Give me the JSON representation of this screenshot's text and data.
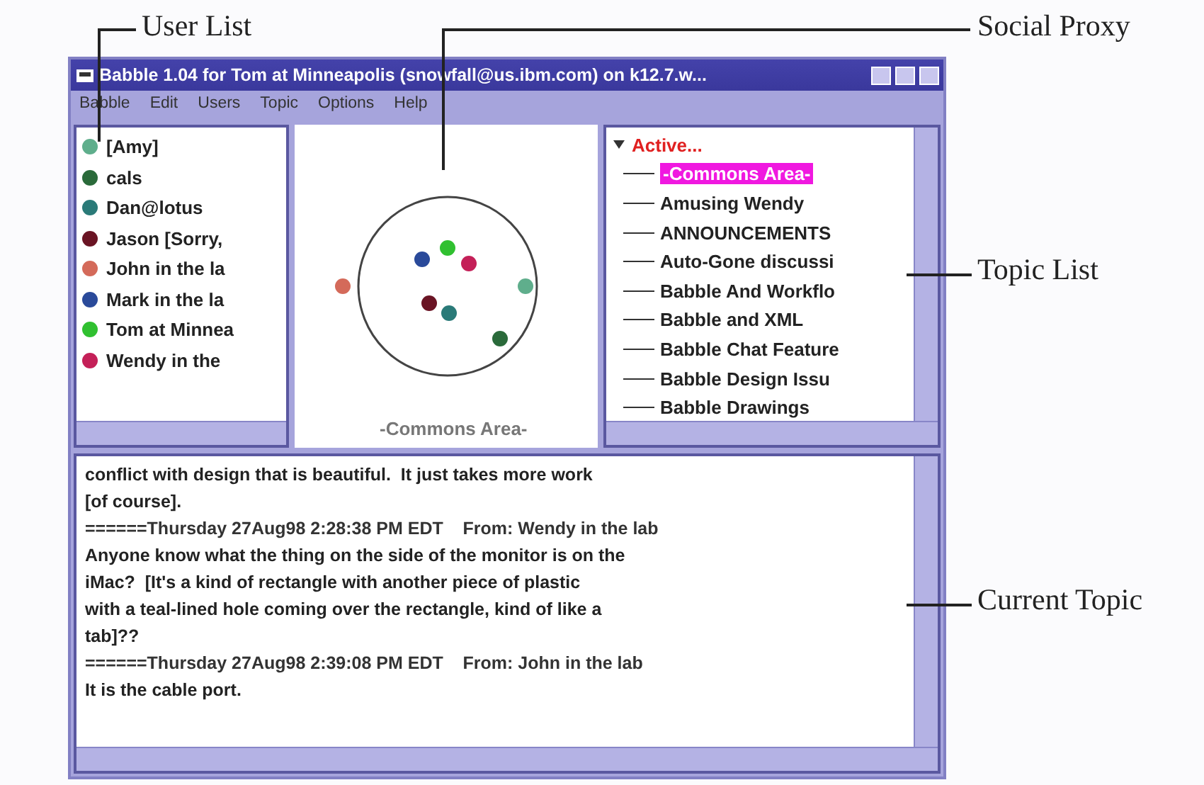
{
  "callouts": [
    {
      "label": "User List"
    },
    {
      "label": "Social Proxy"
    },
    {
      "label": "Topic List"
    },
    {
      "label": "Current Topic"
    }
  ],
  "window": {
    "title": "Babble 1.04 for Tom at Minneapolis (snowfall@us.ibm.com) on k12.7.w..."
  },
  "menu": [
    "Babble",
    "Edit",
    "Users",
    "Topic",
    "Options",
    "Help"
  ],
  "users": [
    {
      "name": "[Amy]",
      "color": "#5fae8c"
    },
    {
      "name": "cals",
      "color": "#2a6a3a"
    },
    {
      "name": "Dan@lotus",
      "color": "#2a7a78"
    },
    {
      "name": "Jason [Sorry, ",
      "color": "#6a1424"
    },
    {
      "name": "John in the la",
      "color": "#d46a5a"
    },
    {
      "name": "Mark in the la",
      "color": "#2a4a9a"
    },
    {
      "name": "Tom at Minnea",
      "color": "#30c030"
    },
    {
      "name": "Wendy in the",
      "color": "#c42058"
    }
  ],
  "proxy": {
    "place": "-Commons Area-"
  },
  "topics": [
    {
      "label": "Active...",
      "expanded": true,
      "children": [
        {
          "label": "-Commons Area-",
          "selected": true
        },
        {
          "label": "Amusing Wendy",
          "selected": false
        },
        {
          "label": "ANNOUNCEMENTS",
          "selected": false
        },
        {
          "label": "Auto-Gone discussi",
          "selected": false
        },
        {
          "label": "Babble And Workflo",
          "selected": false
        },
        {
          "label": "Babble and XML",
          "selected": false
        },
        {
          "label": "Babble Chat Feature",
          "selected": false
        },
        {
          "label": "Babble Design Issu",
          "selected": false
        },
        {
          "label": "Babble Drawings",
          "selected": false
        }
      ]
    }
  ],
  "messages": [
    {
      "kind": "text",
      "text": "conflict with design that is beautiful.  It just takes more work"
    },
    {
      "kind": "text",
      "text": "[of course]."
    },
    {
      "kind": "header",
      "text": "======Thursday 27Aug98 2:28:38 PM EDT    From: Wendy in the lab"
    },
    {
      "kind": "text",
      "text": "Anyone know what the thing on the side of the monitor is on the"
    },
    {
      "kind": "text",
      "text": "iMac?  [It's a kind of rectangle with another piece of plastic"
    },
    {
      "kind": "text",
      "text": "with a teal-lined hole coming over the rectangle, kind of like a"
    },
    {
      "kind": "text",
      "text": "tab]??"
    },
    {
      "kind": "header",
      "text": "======Thursday 27Aug98 2:39:08 PM EDT    From: John in the lab"
    },
    {
      "kind": "text",
      "text": "It is the cable port."
    }
  ]
}
